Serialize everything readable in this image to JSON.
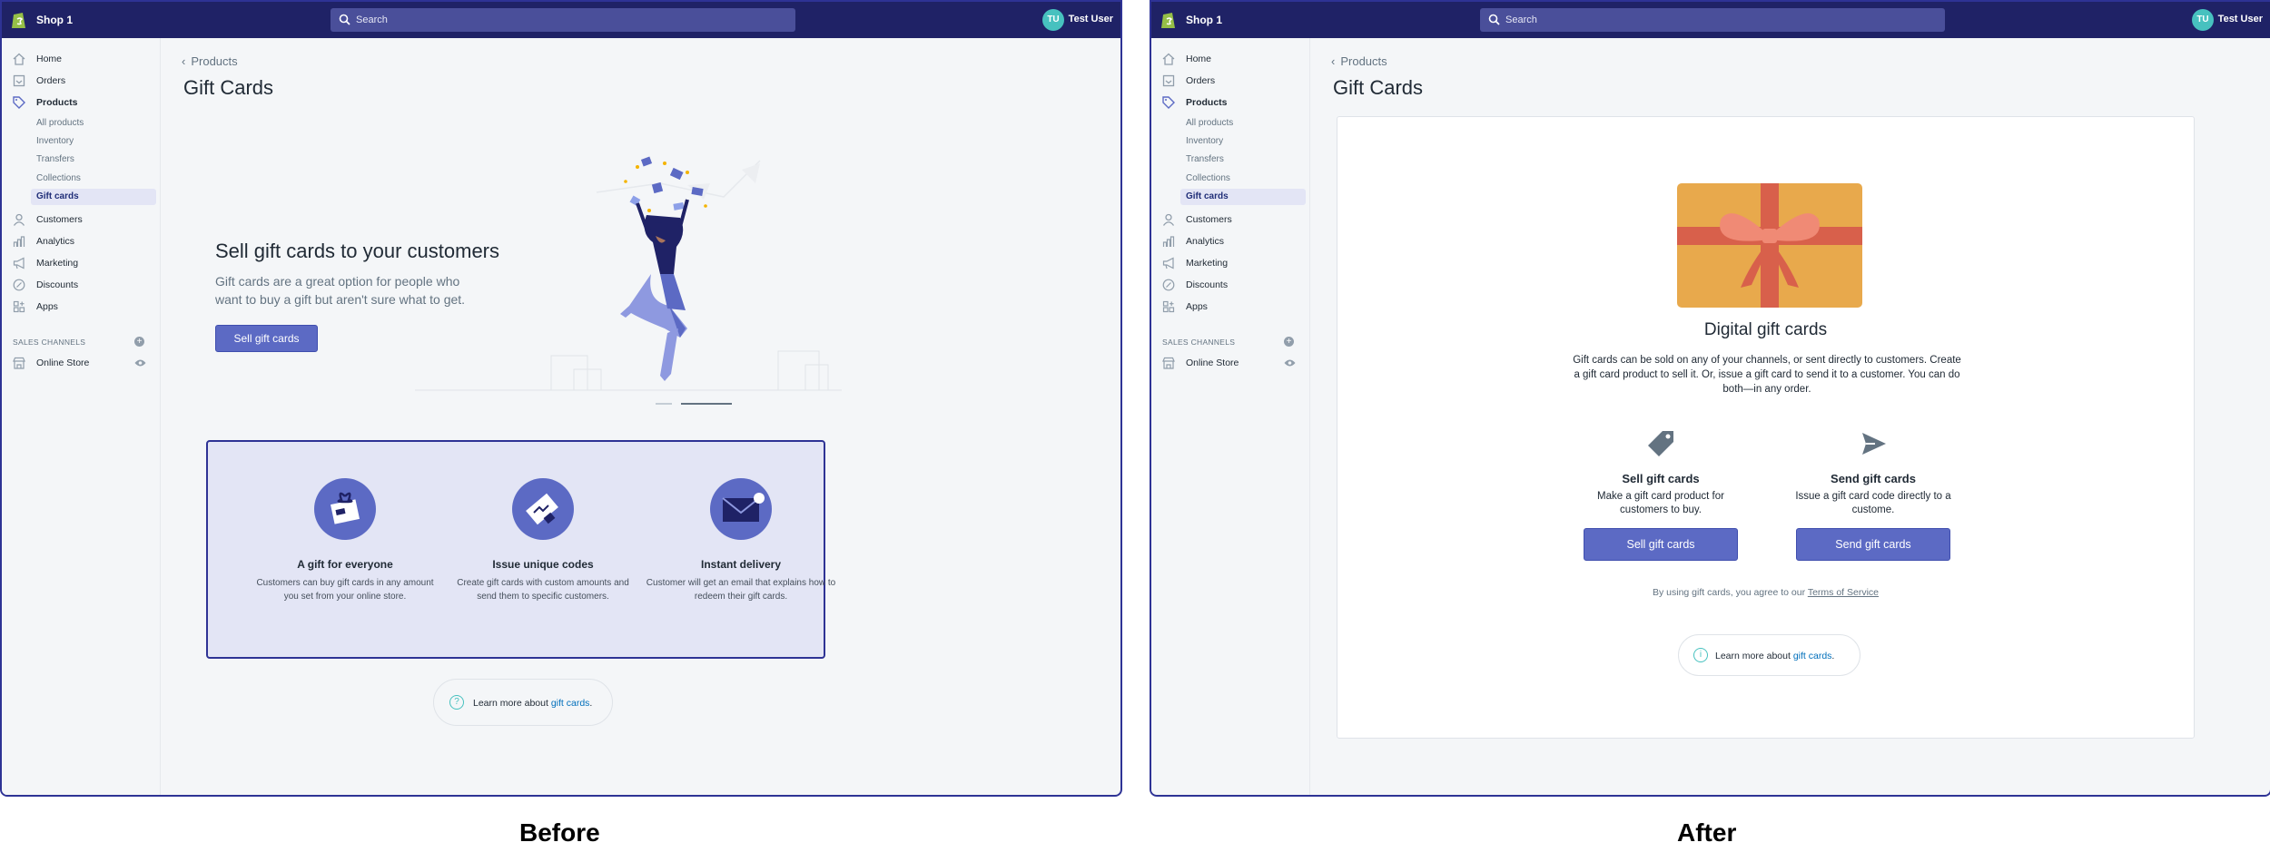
{
  "before": {
    "topbar": {
      "shop_name": "Shop 1",
      "search_placeholder": "Search",
      "avatar_initials": "TU",
      "user_name": "Test User"
    },
    "sidebar": {
      "items": [
        {
          "label": "Home"
        },
        {
          "label": "Orders"
        },
        {
          "label": "Products"
        }
      ],
      "subitems": [
        {
          "label": "All products"
        },
        {
          "label": "Inventory"
        },
        {
          "label": "Transfers"
        },
        {
          "label": "Collections"
        },
        {
          "label": "Gift cards"
        }
      ],
      "items2": [
        {
          "label": "Customers"
        },
        {
          "label": "Analytics"
        },
        {
          "label": "Marketing"
        },
        {
          "label": "Discounts"
        },
        {
          "label": "Apps"
        }
      ],
      "sales_channels_label": "SALES CHANNELS",
      "online_store": "Online Store"
    },
    "breadcrumb": "Products",
    "page_title": "Gift Cards",
    "hero": {
      "title": "Sell gift cards to your customers",
      "description": "Gift cards are a great option for people who want to buy a gift but aren't sure what to get.",
      "button": "Sell gift cards"
    },
    "features": [
      {
        "title": "A gift for everyone",
        "description": "Customers can buy gift cards in any amount you set from your online store."
      },
      {
        "title": "Issue unique codes",
        "description": "Create gift cards with custom amounts and send them to specific customers."
      },
      {
        "title": "Instant delivery",
        "description": "Customer will get an email that explains how to redeem their gift cards."
      }
    ],
    "learn_more": {
      "prefix": "Learn more about ",
      "link": "gift cards",
      "suffix": "."
    }
  },
  "after": {
    "topbar": {
      "shop_name": "Shop 1",
      "search_placeholder": "Search",
      "avatar_initials": "TU",
      "user_name": "Test User"
    },
    "sidebar": {
      "items": [
        {
          "label": "Home"
        },
        {
          "label": "Orders"
        },
        {
          "label": "Products"
        }
      ],
      "subitems": [
        {
          "label": "All products"
        },
        {
          "label": "Inventory"
        },
        {
          "label": "Transfers"
        },
        {
          "label": "Collections"
        },
        {
          "label": "Gift cards"
        }
      ],
      "items2": [
        {
          "label": "Customers"
        },
        {
          "label": "Analytics"
        },
        {
          "label": "Marketing"
        },
        {
          "label": "Discounts"
        },
        {
          "label": "Apps"
        }
      ],
      "sales_channels_label": "SALES CHANNELS",
      "online_store": "Online Store"
    },
    "breadcrumb": "Products",
    "page_title": "Gift Cards",
    "card": {
      "title": "Digital gift cards",
      "description": "Gift cards can be sold on any of your channels, or sent directly to customers. Create a gift card product to sell it. Or, issue a gift card to send it to a customer. You can do both—in any order.",
      "options": [
        {
          "title": "Sell gift cards",
          "description": "Make a gift card product for customers to buy.",
          "button": "Sell gift cards"
        },
        {
          "title": "Send gift cards",
          "description": "Issue a gift card code directly to a custome.",
          "button": "Send gift cards"
        }
      ],
      "tos_prefix": "By using gift cards, you agree to our ",
      "tos_link": "Terms of Service",
      "learn_more": {
        "prefix": "Learn more about ",
        "link": "gift cards",
        "suffix": "."
      }
    }
  },
  "captions": {
    "before": "Before",
    "after": "After"
  },
  "colors": {
    "topbar": "#1f2266",
    "accent": "#5c6ac4",
    "highlight_border": "#2e3395",
    "feature_bg": "#e3e5f5",
    "gift_gold": "#e8a94c",
    "gift_ribbon": "#d8604b",
    "link": "#006fbb"
  }
}
